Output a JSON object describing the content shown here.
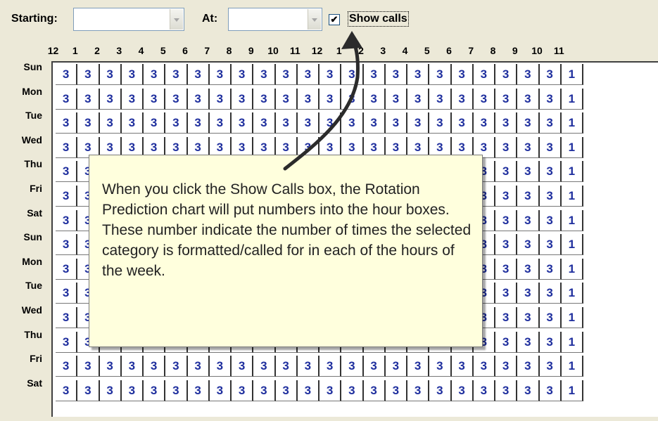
{
  "toolbar": {
    "starting_label": "Starting:",
    "starting_value": "",
    "at_label": "At:",
    "at_value": "",
    "show_calls_checked": "✔",
    "show_calls_label": "Show calls"
  },
  "grid": {
    "hours": [
      "12",
      "1",
      "2",
      "3",
      "4",
      "5",
      "6",
      "7",
      "8",
      "9",
      "10",
      "11",
      "12",
      "1",
      "2",
      "3",
      "4",
      "5",
      "6",
      "7",
      "8",
      "9",
      "10",
      "11"
    ],
    "days": [
      "Sun",
      "Mon",
      "Tue",
      "Wed",
      "Thu",
      "Fri",
      "Sat",
      "Sun",
      "Mon",
      "Tue",
      "Wed",
      "Thu",
      "Fri",
      "Sat"
    ],
    "default_value": "3",
    "last_column_value": "1"
  },
  "callout": {
    "text": "When you click the Show Calls box, the Rotation Prediction chart will put numbers into the hour boxes. These number indicate the number of times the selected category is formatted/called for in each of the hours of the week."
  },
  "colors": {
    "cell_text": "#1f2f9e",
    "callout_bg": "#ffffdd",
    "window_bg": "#ece9d8"
  }
}
